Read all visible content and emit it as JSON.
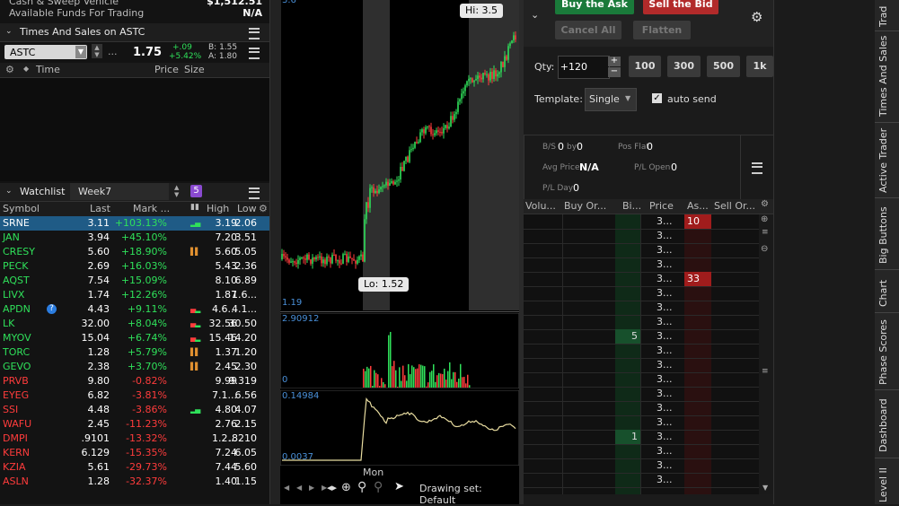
{
  "account": {
    "cash_label": "Cash & Sweep Vehicle",
    "cash_value": "$1,512.51",
    "funds_label": "Available Funds For Trading",
    "funds_value": "N/A"
  },
  "times_sales": {
    "title": "Times And Sales on ASTC",
    "symbol": "ASTC",
    "ellipsis": "...",
    "last": "1.75",
    "change": "+.09",
    "change_pct": "+5.42%",
    "bid": "B: 1.55",
    "ask": "A: 1.80",
    "col_time": "Time",
    "col_price": "Price",
    "col_size": "Size"
  },
  "watchlist": {
    "title": "Watchlist",
    "name": "Week7",
    "badge": "5",
    "headers": {
      "symbol": "Symbol",
      "last": "Last",
      "mark": "Mark ...",
      "high": "High",
      "low": "Low"
    },
    "rows": [
      {
        "symbol": "SRNE",
        "last": "3.11",
        "mark": "+103.13%",
        "high": "3.19",
        "low": "2.06",
        "dir": "pos",
        "selected": true,
        "mini": "up"
      },
      {
        "symbol": "JAN",
        "last": "3.94",
        "mark": "+45.10%",
        "high": "7.20",
        "low": "3.51",
        "dir": "pos",
        "mini": ""
      },
      {
        "symbol": "CRESY",
        "last": "5.60",
        "mark": "+18.90%",
        "high": "5.60",
        "low": "5.05",
        "dir": "pos",
        "mini": "orange"
      },
      {
        "symbol": "PECK",
        "last": "2.69",
        "mark": "+16.03%",
        "high": "5.43",
        "low": "2.36",
        "dir": "pos",
        "mini": ""
      },
      {
        "symbol": "AQST",
        "last": "7.54",
        "mark": "+15.09%",
        "high": "8.10",
        "low": "6.89",
        "dir": "pos",
        "mini": ""
      },
      {
        "symbol": "LIVX",
        "last": "1.74",
        "mark": "+12.26%",
        "high": "1.87",
        "low": "1.6...",
        "dir": "pos",
        "mini": ""
      },
      {
        "symbol": "APDN",
        "last": "4.43",
        "mark": "+9.11%",
        "high": "4.6...",
        "low": "4.1...",
        "dir": "pos",
        "mini": "mixed",
        "info": "?"
      },
      {
        "symbol": "LK",
        "last": "32.00",
        "mark": "+8.04%",
        "high": "32.56",
        "low": "30.50",
        "dir": "pos",
        "mini": "mixed"
      },
      {
        "symbol": "MYOV",
        "last": "15.04",
        "mark": "+6.74%",
        "high": "15.46",
        "low": "14.20",
        "dir": "pos",
        "mini": "mixed"
      },
      {
        "symbol": "TORC",
        "last": "1.28",
        "mark": "+5.79%",
        "high": "1.37",
        "low": "1.20",
        "dir": "pos",
        "mini": "orange"
      },
      {
        "symbol": "GEVO",
        "last": "2.38",
        "mark": "+3.70%",
        "high": "2.45",
        "low": "2.30",
        "dir": "pos",
        "mini": "orange"
      },
      {
        "symbol": "PRVB",
        "last": "9.80",
        "mark": "-0.82%",
        "high": "9.99",
        "low": "9.319",
        "dir": "neg",
        "mini": ""
      },
      {
        "symbol": "EYEG",
        "last": "6.82",
        "mark": "-3.81%",
        "high": "7.1...",
        "low": "6.56",
        "dir": "neg",
        "mini": ""
      },
      {
        "symbol": "SSI",
        "last": "4.48",
        "mark": "-3.86%",
        "high": "4.80",
        "low": "4.07",
        "dir": "neg",
        "mini": "up"
      },
      {
        "symbol": "WAFU",
        "last": "2.45",
        "mark": "-11.23%",
        "high": "2.76",
        "low": "2.15",
        "dir": "neg",
        "mini": ""
      },
      {
        "symbol": "DMPI",
        "last": ".9101",
        "mark": "-13.32%",
        "high": "1.2...",
        "low": ".8210",
        "dir": "neg",
        "mini": ""
      },
      {
        "symbol": "KERN",
        "last": "6.129",
        "mark": "-15.35%",
        "high": "7.24",
        "low": "6.05",
        "dir": "neg",
        "mini": ""
      },
      {
        "symbol": "KZIA",
        "last": "5.61",
        "mark": "-29.73%",
        "high": "7.44",
        "low": "5.60",
        "dir": "neg",
        "mini": ""
      },
      {
        "symbol": "ASLN",
        "last": "1.28",
        "mark": "-32.37%",
        "high": "1.40",
        "low": "1.15",
        "dir": "neg",
        "mini": ""
      }
    ]
  },
  "chart": {
    "hi_label": "Hi: 3.5",
    "lo_label": "Lo: 1.52",
    "price_axis_low": "1.19",
    "volume_max": "2.90912",
    "volume_zero": "0",
    "study_max": "0.14984",
    "study_min": "0.0037",
    "day_label": "Mon",
    "drawing_set": "Drawing set: Default"
  },
  "active_trader": {
    "buy_ask": "Buy the Ask",
    "sell_bid": "Sell the Bid",
    "cancel_all": "Cancel All",
    "flatten": "Flatten",
    "qty_label": "Qty:",
    "qty_value": "+120",
    "qty_presets": [
      "100",
      "300",
      "500",
      "1k"
    ],
    "template_label": "Template:",
    "template_value": "Single",
    "auto_send": "auto send",
    "stats": {
      "bs_label": "B/S",
      "bs_value": "0",
      "by_label": "by",
      "by_value": "0",
      "pos_flat_label": "Pos Flat",
      "pos_flat_value": "0",
      "avg_price_label": "Avg Price",
      "avg_price_value": "N/A",
      "pl_open_label": "P/L Open",
      "pl_open_value": "0",
      "pl_day_label": "P/L Day",
      "pl_day_value": "0"
    },
    "ladder_headers": {
      "volume": "Volu...",
      "buy_orders": "Buy Or...",
      "bid": "Bi...",
      "price": "Price",
      "ask": "As...",
      "sell_orders": "Sell Or..."
    },
    "ladder_rows": [
      {
        "price": "3...",
        "bid": "",
        "ask": "10"
      },
      {
        "price": "3...",
        "bid": "",
        "ask": ""
      },
      {
        "price": "3...",
        "bid": "",
        "ask": ""
      },
      {
        "price": "3...",
        "bid": "",
        "ask": ""
      },
      {
        "price": "3...",
        "bid": "",
        "ask": "33"
      },
      {
        "price": "3...",
        "bid": "",
        "ask": ""
      },
      {
        "price": "3...",
        "bid": "",
        "ask": ""
      },
      {
        "price": "3...",
        "bid": "",
        "ask": ""
      },
      {
        "price": "3...",
        "bid": "5",
        "ask": ""
      },
      {
        "price": "3...",
        "bid": "",
        "ask": ""
      },
      {
        "price": "3...",
        "bid": "",
        "ask": ""
      },
      {
        "price": "3...",
        "bid": "",
        "ask": ""
      },
      {
        "price": "3...",
        "bid": "",
        "ask": ""
      },
      {
        "price": "3...",
        "bid": "",
        "ask": ""
      },
      {
        "price": "3...",
        "bid": "",
        "ask": ""
      },
      {
        "price": "3...",
        "bid": "1",
        "ask": ""
      },
      {
        "price": "3...",
        "bid": "",
        "ask": ""
      },
      {
        "price": "3...",
        "bid": "",
        "ask": ""
      },
      {
        "price": "3...",
        "bid": "",
        "ask": ""
      }
    ]
  },
  "side_tabs": [
    "Trad",
    "Times And Sales",
    "Active Trader",
    "Big Buttons",
    "Chart",
    "Phase Scores",
    "Dashboard",
    "Level II"
  ]
}
